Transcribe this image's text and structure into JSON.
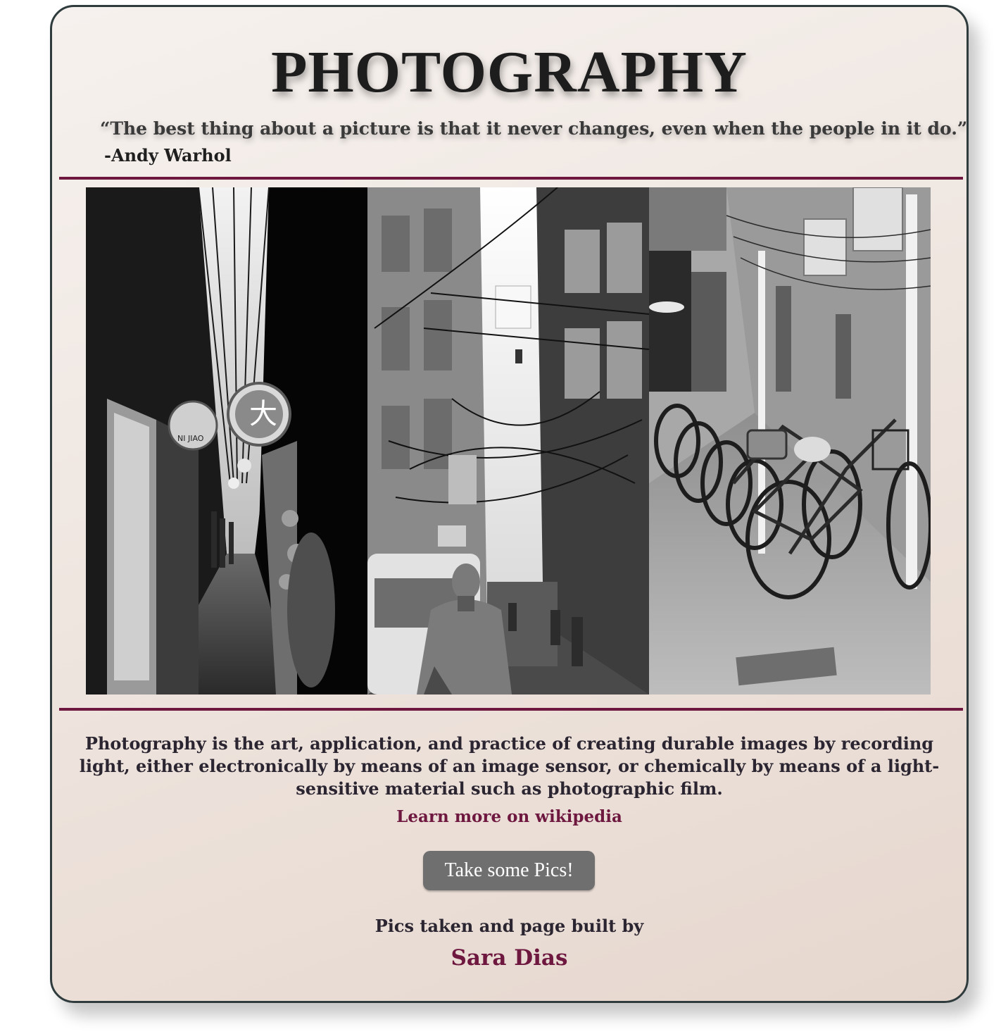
{
  "header": {
    "title": "PHOTOGRAPHY",
    "quote": "“The best thing about a picture is that it never changes, even when the people in it do.”",
    "quote_author": "-Andy Warhol"
  },
  "gallery": {
    "photos": [
      {
        "name": "alley-lanterns-photo",
        "sign_text": "NI JIAO"
      },
      {
        "name": "street-wires-photo"
      },
      {
        "name": "parked-bicycles-photo"
      }
    ]
  },
  "main": {
    "description": "Photography is the art, application, and practice of creating durable images by recording light, either electronically by means of an image sensor, or chemically by means of a light-sensitive material such as photographic film.",
    "wiki_link": "Learn more on wikipedia",
    "cta_button": "Take some Pics!",
    "credit": "Pics taken and page built by",
    "author": "Sara Dias"
  },
  "colors": {
    "accent": "#6e1840",
    "border": "#2f3b3d",
    "button": "#6f6f6f"
  }
}
